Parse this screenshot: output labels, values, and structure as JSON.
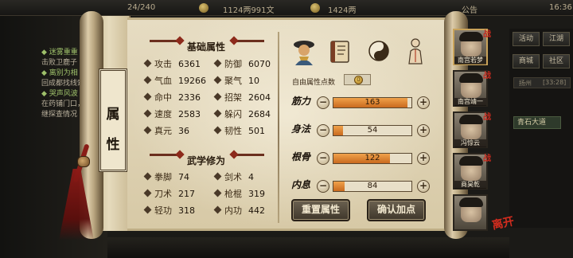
{
  "topbar": {
    "exp_label": "24/240",
    "silver": "1124两991文",
    "gold": "1424两",
    "announce": "公告",
    "time": "16:36"
  },
  "left_log": [
    {
      "text": "◆ 迷雾重重",
      "style": "green"
    },
    {
      "text": "击败卫鹿子",
      "style": "dim"
    },
    {
      "text": "◆ 离别为相",
      "style": "green"
    },
    {
      "text": "回成都找线索",
      "style": "dim"
    },
    {
      "text": "◆ 哭声风波",
      "style": "green"
    },
    {
      "text": "在药铺门口，",
      "style": "dim"
    },
    {
      "text": "继探查情况",
      "style": "dim"
    }
  ],
  "right_menu": {
    "buttons": [
      "活动",
      "江湖",
      "商城",
      "社区"
    ],
    "location": "扬州",
    "location_time": "[33:28]",
    "quest_chip": "青石大道"
  },
  "title": [
    "属",
    "性"
  ],
  "basic": {
    "header": "基础属性",
    "stats": [
      {
        "label": "攻击",
        "value": "6361"
      },
      {
        "label": "防御",
        "value": "6070"
      },
      {
        "label": "气血",
        "value": "19266"
      },
      {
        "label": "聚气",
        "value": "10"
      },
      {
        "label": "命中",
        "value": "2336"
      },
      {
        "label": "招架",
        "value": "2604"
      },
      {
        "label": "速度",
        "value": "2583"
      },
      {
        "label": "躲闪",
        "value": "2684"
      },
      {
        "label": "真元",
        "value": "36"
      },
      {
        "label": "韧性",
        "value": "501"
      }
    ]
  },
  "martial": {
    "header": "武学修为",
    "stats": [
      {
        "label": "拳脚",
        "value": "74"
      },
      {
        "label": "剑术",
        "value": "4"
      },
      {
        "label": "刀术",
        "value": "217"
      },
      {
        "label": "枪棍",
        "value": "319"
      },
      {
        "label": "轻功",
        "value": "318"
      },
      {
        "label": "内功",
        "value": "442"
      }
    ]
  },
  "tabs": [
    {
      "name": "character-tab",
      "label": ""
    },
    {
      "name": "attribute-tab",
      "label": "属性"
    },
    {
      "name": "taiji-tab",
      "label": ""
    },
    {
      "name": "meridian-tab",
      "label": ""
    }
  ],
  "free_points": {
    "label": "自由属性点数",
    "value": "0"
  },
  "attributes": [
    {
      "label": "筋力",
      "value": "163",
      "fill": 0.95
    },
    {
      "label": "身法",
      "value": "54",
      "fill": 0.12
    },
    {
      "label": "根骨",
      "value": "122",
      "fill": 0.72
    },
    {
      "label": "内息",
      "value": "84",
      "fill": 0.14
    }
  ],
  "buttons": {
    "reset": "重置属性",
    "confirm": "确认加点"
  },
  "characters": [
    {
      "name": "南宫若梦",
      "mark": "战",
      "active": true
    },
    {
      "name": "南宫靖一",
      "mark": "战",
      "active": false
    },
    {
      "name": "冯惊云",
      "mark": "战",
      "active": false
    },
    {
      "name": "商昊乾",
      "mark": "战",
      "active": false
    },
    {
      "name": "",
      "mark": "",
      "active": false
    }
  ],
  "seal_text": "离开"
}
